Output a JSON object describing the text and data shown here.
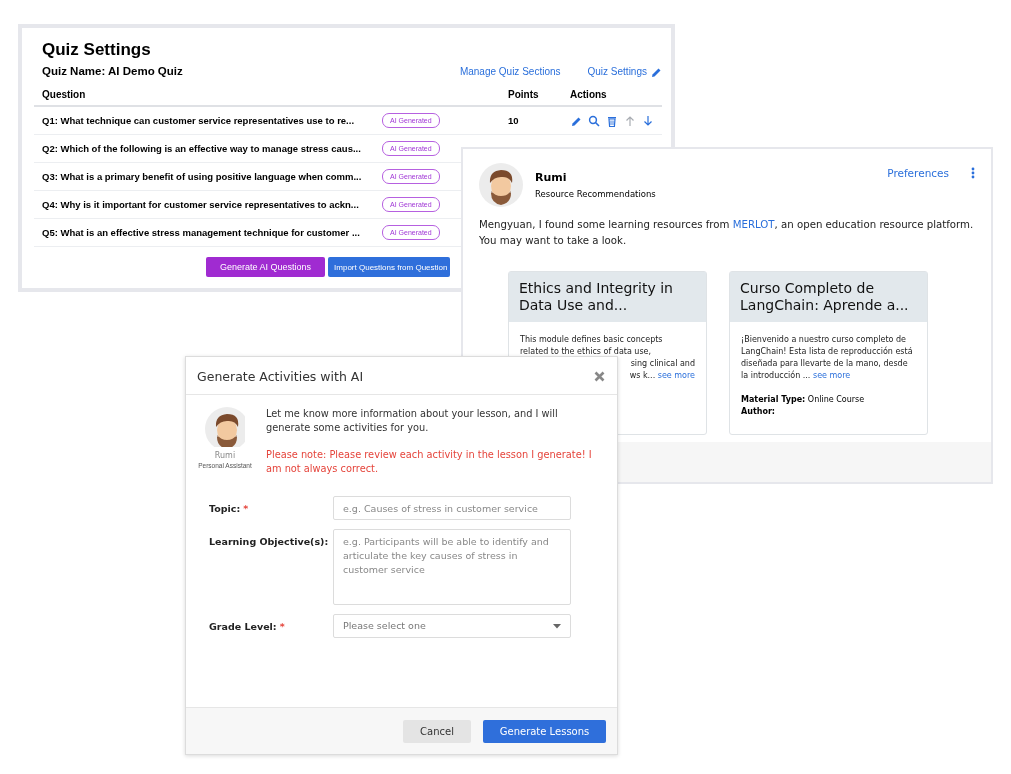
{
  "quiz_window": {
    "title": "Quiz Settings",
    "quiz_name": "Quiz Name: AI Demo Quiz",
    "links": [
      {
        "label": "Manage Quiz Sections"
      },
      {
        "label": "Quiz Settings",
        "icon": true
      }
    ],
    "columns": [
      "Question",
      "Points",
      "Actions"
    ],
    "rows": [
      {
        "question": "Q1:  What technique can customer service representatives use to re...",
        "badge": "AI Generated",
        "points": "10",
        "actions": [
          {
            "kind": "edit",
            "disabled": false
          },
          {
            "kind": "preview",
            "disabled": false
          },
          {
            "kind": "delete",
            "disabled": false
          },
          {
            "kind": "up",
            "disabled": true
          },
          {
            "kind": "down",
            "disabled": false
          }
        ]
      },
      {
        "question": "Q2:  Which of the following is an effective way to manage stress caus...",
        "badge": "AI Generated"
      },
      {
        "question": "Q3:  What is a primary benefit of using positive language when comm...",
        "badge": "AI Generated"
      },
      {
        "question": "Q4:  Why is it important for customer service representatives to ackn...",
        "badge": "AI Generated"
      },
      {
        "question": "Q5:  What is an effective stress management technique for customer ...",
        "badge": "AI Generated"
      }
    ],
    "buttons": [
      {
        "label": "Generate AI Questions",
        "kind": "ai"
      },
      {
        "label": "Import Questions from Question",
        "kind": "import"
      }
    ]
  },
  "resource_panel": {
    "name": "Rumi",
    "subtitle": "Resource Recommendations",
    "preferences": "Preferences",
    "message": [
      "Mengyuan, I found some learning resources from ",
      "MERLOT",
      ", an open education resource platform. You may want to take a look."
    ],
    "cards": [
      {
        "title": "Ethics and Integrity in Data Use and...",
        "lines": [
          {
            "text": "This module defines basic concepts",
            "kind": "full"
          },
          {
            "text": "related to the ethics of data use,",
            "kind": "full"
          },
          {
            "text": "sing clinical and",
            "kind": "tail"
          },
          {
            "text": "ws k...",
            "kind": "tail",
            "link": "see more"
          }
        ]
      },
      {
        "title": "Curso Completo de LangChain: Aprende a...",
        "lines": [
          {
            "text": "¡Bienvenido a nuestro curso completo de LangChain! Esta lista de reproducción está diseñada para llevarte de la mano, desde la introducción ...",
            "kind": "full",
            "link": "see more"
          }
        ],
        "material_label": "Material Type:",
        "material_value": "Online Course",
        "author_label": "Author:"
      }
    ]
  },
  "dialog": {
    "title": "Generate Activities with AI",
    "assistant_name": "Rumi",
    "assistant_role": "Personal Assistant",
    "intro": "Let me know more information about your lesson, and I will generate some activities for you.",
    "note": "Please note: Please review each activity in the lesson I generate! I am not always correct.",
    "fields": [
      {
        "kind": "input",
        "label": "Topic:",
        "required_mark": "*",
        "placeholder": "e.g. Causes of stress in customer service"
      },
      {
        "kind": "textarea",
        "label": "Learning Objective(s):",
        "placeholder": "e.g. Participants will be able to identify and articulate the key causes of stress in customer service"
      },
      {
        "kind": "select",
        "label": "Grade Level:",
        "required_mark": "*",
        "placeholder": "Please select one"
      }
    ],
    "buttons": [
      {
        "label": "Cancel",
        "kind": "secondary"
      },
      {
        "label": "Generate Lessons",
        "kind": "primary"
      }
    ]
  }
}
